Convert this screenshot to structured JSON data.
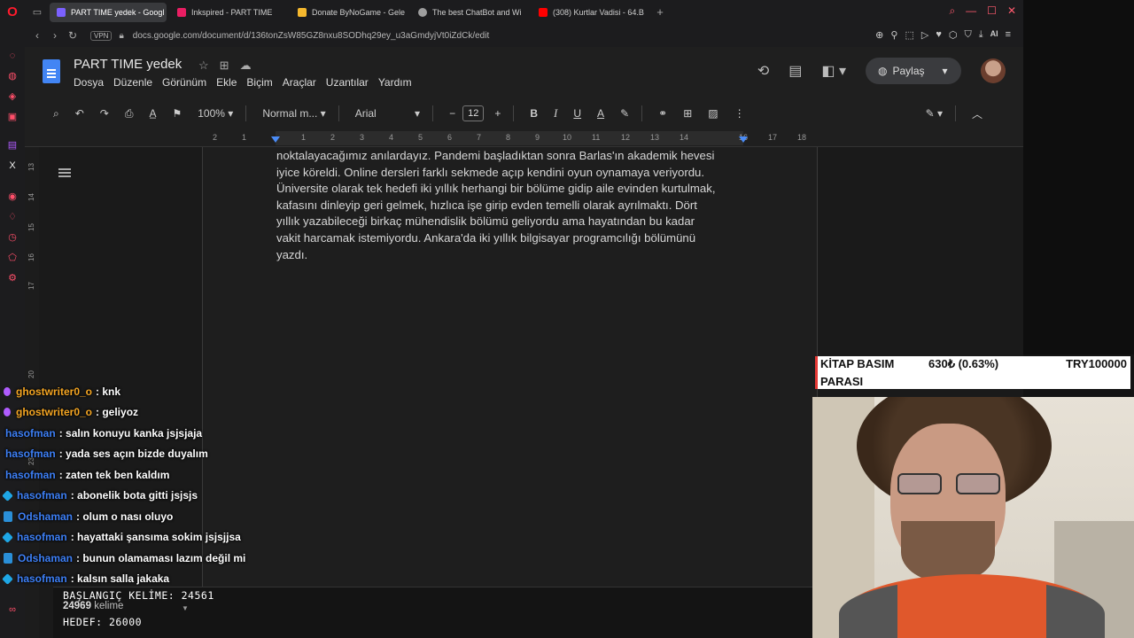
{
  "browser": {
    "tabs": [
      {
        "label": "PART TIME yedek - Googl",
        "color": "#7b61ff",
        "active": true
      },
      {
        "label": "Inkspired - PART TIME",
        "color": "#e91e63",
        "active": false
      },
      {
        "label": "Donate ByNoGame - Gele",
        "color": "#f5b82e",
        "active": false
      },
      {
        "label": "The best ChatBot and Wi",
        "color": "#9e9e9e",
        "active": false
      },
      {
        "label": "(308) Kurtlar Vadisi - 64.B",
        "color": "#ff0000",
        "active": false
      }
    ],
    "new_tab": "+",
    "vpn": "VPN",
    "url": "docs.google.com/document/d/136tonZsW85GZ8nxu8SODhq29ey_u3aGmdyjVt0iZdCk/edit",
    "ai_label": "AI"
  },
  "docs": {
    "title": "PART TIME yedek",
    "menu": [
      "Dosya",
      "Düzenle",
      "Görünüm",
      "Ekle",
      "Biçim",
      "Araçlar",
      "Uzantılar",
      "Yardım"
    ],
    "share_label": "Paylaş",
    "zoom": "100%",
    "style": "Normal m...",
    "font": "Arial",
    "font_size": "12",
    "bold": "B",
    "italic": "I",
    "underline": "U",
    "text_color": "A",
    "ruler_numbers": [
      "2",
      "1",
      "1",
      "2",
      "3",
      "4",
      "5",
      "6",
      "7",
      "8",
      "9",
      "10",
      "11",
      "12",
      "13",
      "14",
      "15",
      "16",
      "17",
      "18"
    ],
    "vertical_ruler": [
      "13",
      "14",
      "15",
      "16",
      "17",
      "20",
      "23"
    ],
    "body_lines": [
      "noktalayacağımız anılardayız. Pandemi başladıktan sonra Barlas'ın akademik hevesi",
      "iyice köreldi. Online dersleri farklı sekmede açıp kendini oyun oynamaya veriyordu.",
      "Üniversite olarak tek hedefi iki yıllık herhangi bir bölüme gidip aile evinden kurtulmak,",
      "kafasını dinleyip geri gelmek, hızlıca işe girip evden temelli olarak ayrılmaktı. Dört",
      "yıllık yazabileceği birkaç mühendislik bölümü geliyordu ama hayatından bu kadar",
      "vakit harcamak istemiyordu. Ankara'da iki yıllık bilgisayar programcılığı bölümünü",
      "yazdı."
    ],
    "word_count_number": "24969",
    "word_count_label": "kelime"
  },
  "chat": [
    {
      "user": "ghostwriter0_o",
      "message": ": knk",
      "user_color": "#f5a623",
      "badge_color": "#b05cff"
    },
    {
      "user": "ghostwriter0_o",
      "message": ": geliyoz",
      "user_color": "#f5a623",
      "badge_color": "#b05cff"
    },
    {
      "user": "hasofman",
      "message": ": salın konuyu kanka jsjsjaja",
      "user_color": "#3d7ff5",
      "badge_color": ""
    },
    {
      "user": "hasofman",
      "message": ": yada ses açın bizde duyalım",
      "user_color": "#3d7ff5",
      "badge_color": ""
    },
    {
      "user": "hasofman",
      "message": ": zaten tek ben kaldım",
      "user_color": "#3d7ff5",
      "badge_color": ""
    },
    {
      "user": "hasofman",
      "message": ": abonelik bota gitti jsjsjs",
      "user_color": "#3d7ff5",
      "badge_color": "#1ea7e6"
    },
    {
      "user": "Odshaman",
      "message": ": olum o nası oluyo",
      "user_color": "#3d7ff5",
      "badge_color": "#2a8fd8"
    },
    {
      "user": "hasofman",
      "message": ": hayattaki şansıma sokim jsjsjjsa",
      "user_color": "#3d7ff5",
      "badge_color": "#1ea7e6"
    },
    {
      "user": "Odshaman",
      "message": ": bunun olamaması lazım değil mi",
      "user_color": "#3d7ff5",
      "badge_color": "#2a8fd8"
    },
    {
      "user": "hasofman",
      "message": ": kalsın salla jakaka",
      "user_color": "#3d7ff5",
      "badge_color": "#1ea7e6"
    }
  ],
  "stream": {
    "start_words": "BAŞLANGIÇ KELİME: 24561",
    "target": "HEDEF: 26000",
    "fund_title_1": "KİTAP BASIM",
    "fund_title_2": "PARASI",
    "fund_amount": "630₺ (0.63%)",
    "fund_goal": "TRY100000"
  }
}
